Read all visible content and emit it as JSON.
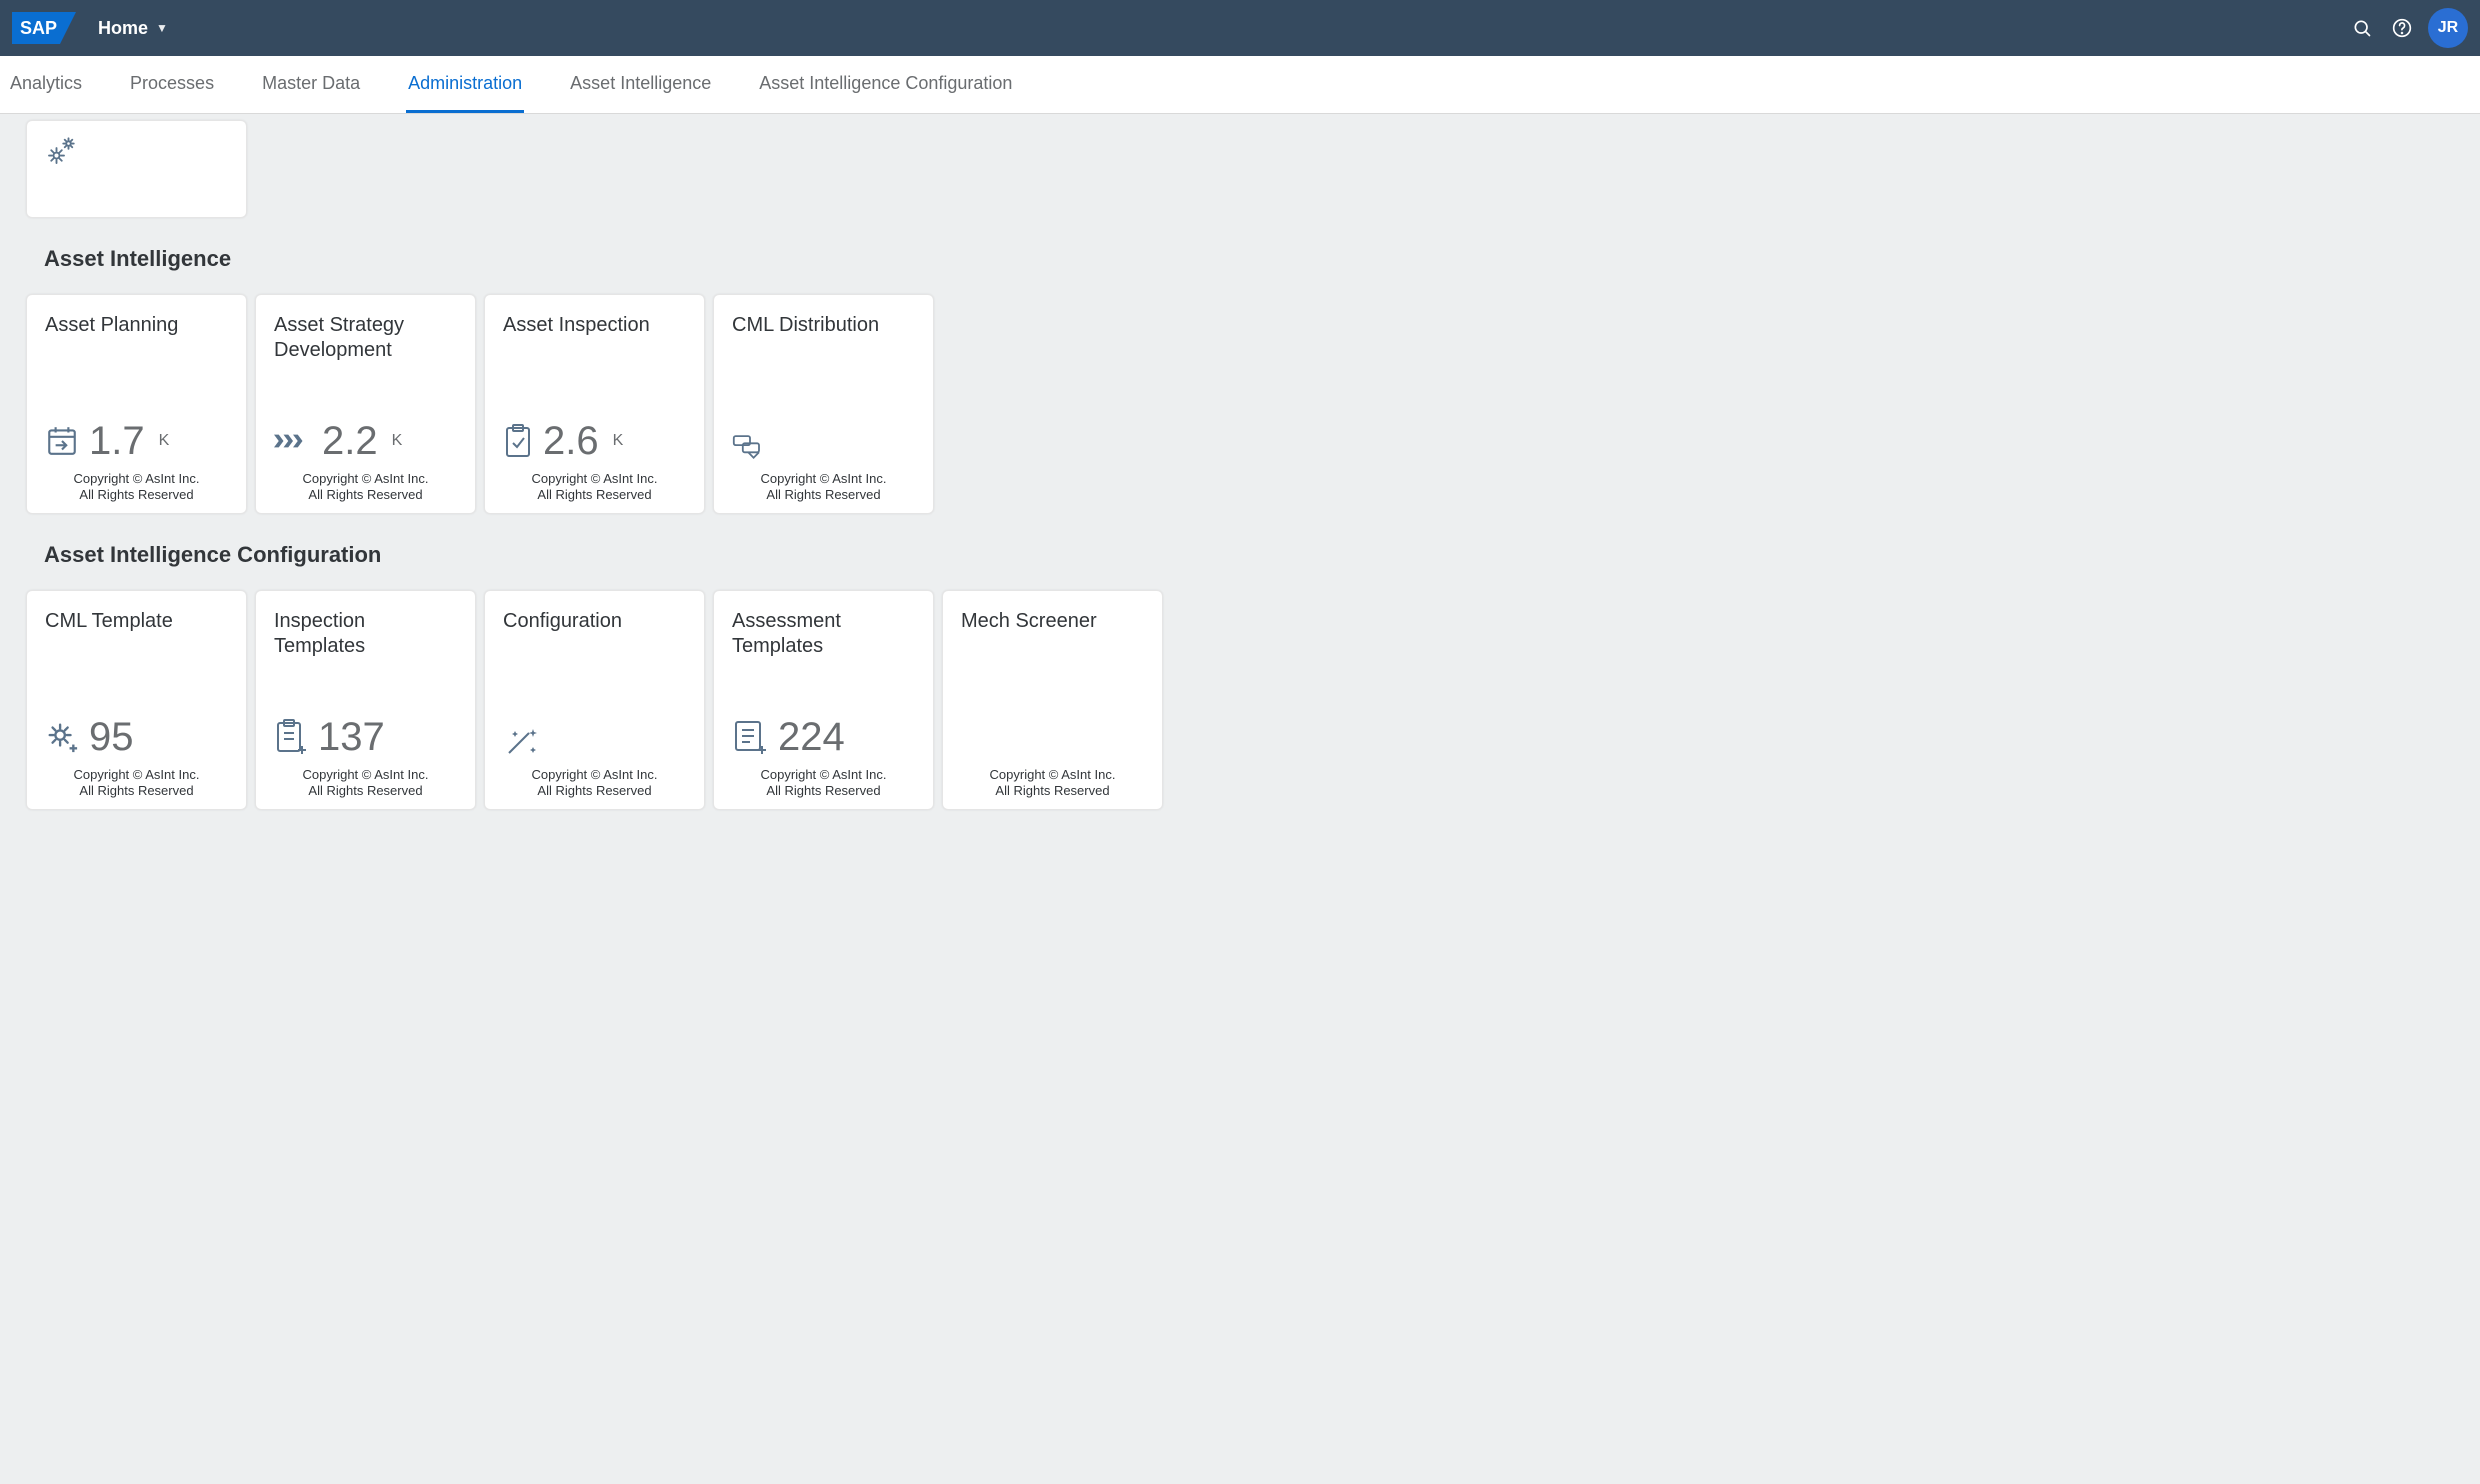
{
  "header": {
    "title": "Home",
    "avatar_initials": "JR",
    "search_aria": "Search",
    "help_aria": "Help"
  },
  "tabs": [
    {
      "label": "Analytics",
      "selected": false
    },
    {
      "label": "Processes",
      "selected": false
    },
    {
      "label": "Master Data",
      "selected": false
    },
    {
      "label": "Administration",
      "selected": true
    },
    {
      "label": "Asset Intelligence",
      "selected": false
    },
    {
      "label": "Asset Intelligence Configuration",
      "selected": false
    }
  ],
  "sections": {
    "asset_intelligence": {
      "title": "Asset Intelligence",
      "tiles": [
        {
          "title": "Asset Planning",
          "icon": "calendar-arrow",
          "value": "1.7",
          "unit": "K"
        },
        {
          "title": "Asset Strategy Development",
          "icon": "chevrons",
          "value": "2.2",
          "unit": "K"
        },
        {
          "title": "Asset Inspection",
          "icon": "clipboard-check",
          "value": "2.6",
          "unit": "K"
        },
        {
          "title": "CML Distribution",
          "icon": "shield-label",
          "value": "",
          "unit": ""
        }
      ]
    },
    "asset_intelligence_config": {
      "title": "Asset Intelligence Configuration",
      "tiles": [
        {
          "title": "CML Template",
          "icon": "gear-plus",
          "value": "95",
          "unit": ""
        },
        {
          "title": "Inspection Templates",
          "icon": "clipboard-plus",
          "value": "137",
          "unit": ""
        },
        {
          "title": "Configuration",
          "icon": "wand",
          "value": "",
          "unit": ""
        },
        {
          "title": "Assessment Templates",
          "icon": "doc-plus",
          "value": "224",
          "unit": ""
        },
        {
          "title": "Mech Screener",
          "icon": "",
          "value": "",
          "unit": ""
        }
      ]
    }
  },
  "footer": {
    "line1": "Copyright © AsInt Inc.",
    "line2": "All Rights Reserved"
  },
  "icons": {
    "search": "search-icon",
    "help": "help-icon",
    "chevron_down": "chevron-down-icon",
    "gears": "gears-icon"
  }
}
